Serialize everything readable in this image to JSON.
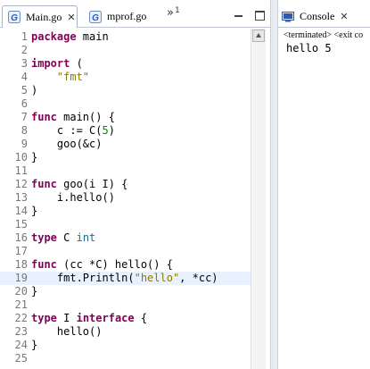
{
  "editor": {
    "tabs": [
      {
        "label": "Main.go",
        "active": true,
        "close": "✕"
      },
      {
        "label": "mprof.go",
        "active": false
      }
    ],
    "overflow": {
      "chevron": "»",
      "count": "1"
    },
    "current_line": 19,
    "lines": [
      {
        "n": "1",
        "tokens": [
          {
            "t": "package",
            "c": "kw"
          },
          {
            "t": " main"
          }
        ]
      },
      {
        "n": "2",
        "tokens": []
      },
      {
        "n": "3",
        "tokens": [
          {
            "t": "import",
            "c": "kw"
          },
          {
            "t": " ("
          }
        ]
      },
      {
        "n": "4",
        "tokens": [
          {
            "t": "    "
          },
          {
            "t": "\"fmt\"",
            "c": "str"
          }
        ]
      },
      {
        "n": "5",
        "tokens": [
          {
            "t": ")"
          }
        ]
      },
      {
        "n": "6",
        "tokens": []
      },
      {
        "n": "7",
        "tokens": [
          {
            "t": "func",
            "c": "kw"
          },
          {
            "t": " main() {"
          }
        ]
      },
      {
        "n": "8",
        "tokens": [
          {
            "t": "    c := C("
          },
          {
            "t": "5",
            "c": "num"
          },
          {
            "t": ")"
          }
        ]
      },
      {
        "n": "9",
        "tokens": [
          {
            "t": "    goo(&c)"
          }
        ]
      },
      {
        "n": "10",
        "tokens": [
          {
            "t": "}"
          }
        ]
      },
      {
        "n": "11",
        "tokens": []
      },
      {
        "n": "12",
        "tokens": [
          {
            "t": "func",
            "c": "kw"
          },
          {
            "t": " goo(i I) {"
          }
        ]
      },
      {
        "n": "13",
        "tokens": [
          {
            "t": "    i.hello()"
          }
        ]
      },
      {
        "n": "14",
        "tokens": [
          {
            "t": "}"
          }
        ]
      },
      {
        "n": "15",
        "tokens": []
      },
      {
        "n": "16",
        "tokens": [
          {
            "t": "type",
            "c": "kw"
          },
          {
            "t": " C "
          },
          {
            "t": "int",
            "c": "typ"
          }
        ]
      },
      {
        "n": "17",
        "tokens": []
      },
      {
        "n": "18",
        "tokens": [
          {
            "t": "func",
            "c": "kw"
          },
          {
            "t": " (cc *C) hello() {"
          }
        ]
      },
      {
        "n": "19",
        "tokens": [
          {
            "t": "    fmt.Println("
          },
          {
            "t": "\"hello\"",
            "c": "str"
          },
          {
            "t": ", *cc)"
          }
        ]
      },
      {
        "n": "20",
        "tokens": [
          {
            "t": "}"
          }
        ]
      },
      {
        "n": "21",
        "tokens": []
      },
      {
        "n": "22",
        "tokens": [
          {
            "t": "type",
            "c": "kw"
          },
          {
            "t": " I "
          },
          {
            "t": "interface",
            "c": "kw"
          },
          {
            "t": " {"
          }
        ]
      },
      {
        "n": "23",
        "tokens": [
          {
            "t": "    hello()"
          }
        ]
      },
      {
        "n": "24",
        "tokens": [
          {
            "t": "}"
          }
        ]
      },
      {
        "n": "25",
        "tokens": []
      }
    ]
  },
  "console": {
    "tab_label": "Console",
    "close": "✕",
    "status": "<terminated> <exit co",
    "output": "hello 5"
  },
  "icons": {
    "go_file": "go-file-icon",
    "console": "console-icon",
    "minimize": "minimize-icon",
    "maximize": "maximize-icon",
    "scroll_up": "scroll-up-arrow-icon"
  },
  "colors": {
    "keyword": "#7f0055",
    "string": "#8c7a00",
    "number": "#008c00",
    "type": "#0d6fa6",
    "current_line": "#e8f2fe",
    "line_number": "#787878"
  }
}
